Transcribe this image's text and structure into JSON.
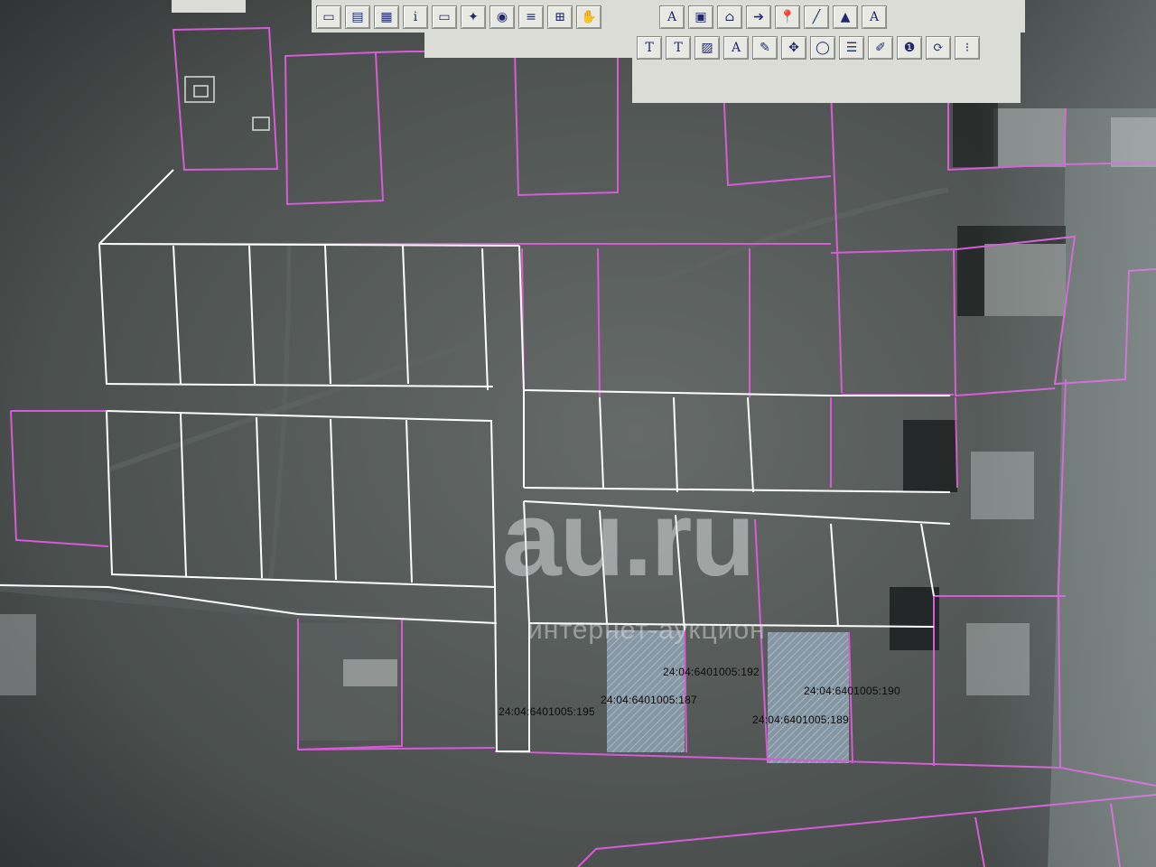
{
  "app": {
    "toolbar_rows": [
      {
        "id": "row1",
        "buttons": [
          {
            "name": "open-file-icon",
            "glyph": "▭"
          },
          {
            "name": "layers-icon",
            "glyph": "▤"
          },
          {
            "name": "table-icon",
            "glyph": "▦"
          },
          {
            "name": "info-icon",
            "glyph": "i"
          },
          {
            "name": "rect-select-icon",
            "glyph": "▭"
          },
          {
            "name": "point-tool-icon",
            "glyph": "✦"
          },
          {
            "name": "target-tool-icon",
            "glyph": "◉"
          },
          {
            "name": "ruler-icon",
            "glyph": "≡"
          },
          {
            "name": "grid-icon",
            "glyph": "⊞"
          },
          {
            "name": "pan-hand-icon",
            "glyph": "✋"
          }
        ]
      },
      {
        "id": "row2",
        "buttons": [
          {
            "name": "text-label-icon",
            "glyph": "A"
          },
          {
            "name": "frame-icon",
            "glyph": "▣"
          },
          {
            "name": "house-icon",
            "glyph": "⌂"
          },
          {
            "name": "arrow-icon",
            "glyph": "➔"
          },
          {
            "name": "pin-help-icon",
            "glyph": "📍"
          },
          {
            "name": "line-help-icon",
            "glyph": "╱"
          },
          {
            "name": "polygon-help-icon",
            "glyph": "▲"
          },
          {
            "name": "text-help-icon",
            "glyph": "A"
          }
        ]
      },
      {
        "id": "row3",
        "buttons": [
          {
            "name": "text-fw-icon",
            "glyph": "T"
          },
          {
            "name": "text-tml-icon",
            "glyph": "T"
          },
          {
            "name": "image-text-icon",
            "glyph": "▨"
          },
          {
            "name": "text-mark-icon",
            "glyph": "A"
          },
          {
            "name": "edit-text-icon",
            "glyph": "✎"
          },
          {
            "name": "compass-icon",
            "glyph": "✥"
          },
          {
            "name": "circle-tool-icon",
            "glyph": "◯"
          },
          {
            "name": "layer-stack-icon",
            "glyph": "☰"
          },
          {
            "name": "map-edit-icon",
            "glyph": "✐"
          },
          {
            "name": "db-info-icon",
            "glyph": "❶"
          },
          {
            "name": "refresh-icon",
            "glyph": "⟳"
          },
          {
            "name": "coordinates-icon",
            "glyph": "⁝"
          }
        ]
      }
    ]
  },
  "parcels": [
    {
      "label": "24:04:6401005:195"
    },
    {
      "label": "24:04:6401005:187"
    },
    {
      "label": "24:04:6401005:192"
    },
    {
      "label": "24:04:6401005:189"
    },
    {
      "label": "24:04:6401005:190"
    }
  ],
  "watermark": {
    "brand": "au.ru",
    "tagline": "интернет-аукцион"
  },
  "colors": {
    "cadastral_boundary": "#d55cd6",
    "planned_plot": "#ffffff",
    "selected_fill": "#8fa3b6",
    "terrain": "#4d5250"
  }
}
